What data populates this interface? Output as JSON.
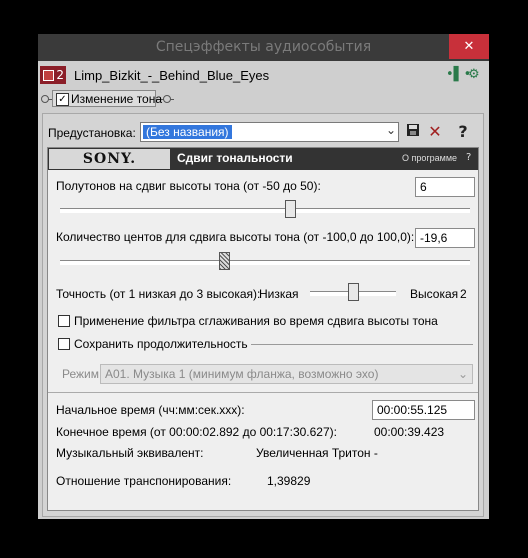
{
  "window": {
    "title": "Спецэффекты аудиособытия",
    "close_label": "✕"
  },
  "track": {
    "number": "2",
    "name": "Limp_Bizkit_-_Behind_Blue_Eyes"
  },
  "chain": {
    "plugin_label": "Изменение тона",
    "checked": "✓"
  },
  "preset": {
    "label": "Предустановка:",
    "value": "(Без названия)",
    "arrow": "⌄",
    "save_icon": "💾",
    "delete_icon": "✕",
    "help_icon": "?"
  },
  "plugin": {
    "brand": "SONY.",
    "title": "Сдвиг тональности",
    "about": "О программе",
    "help": "?",
    "semitones_label": "Полутонов на сдвиг высоты тона (от -50 до 50):",
    "semitones_value": "6",
    "semitones_level": 0.56,
    "cents_label": "Количество центов для сдвига высоты тона (от -100,0 до 100,0):",
    "cents_value": "-19,6",
    "cents_level": 0.4,
    "accuracy_label": "Точность (от 1 низкая до 3 высокая):",
    "accuracy_low": "Низкая",
    "accuracy_high": "Высокая",
    "accuracy_value": "2",
    "accuracy_level": 0.5,
    "antialias_label": "Применение фильтра сглаживания во время сдвига высоты тона",
    "preserve_label": "Сохранить продолжительность",
    "mode_label": "Режим:",
    "mode_value": "A01. Музыка 1 (минимум фланжа, возможно эхо)",
    "start_label": "Начальное время (чч:мм:сек.ххх):",
    "start_value": "00:00:55.125",
    "end_label": "Конечное время (от 00:00:02.892 до 00:17:30.627):",
    "end_value": "00:00:39.423",
    "musical_label": "Музыкальный эквивалент:",
    "musical_value": "Увеличенная Тритон -",
    "ratio_label": "Отношение транспонирования:",
    "ratio_value": "1,39829"
  }
}
